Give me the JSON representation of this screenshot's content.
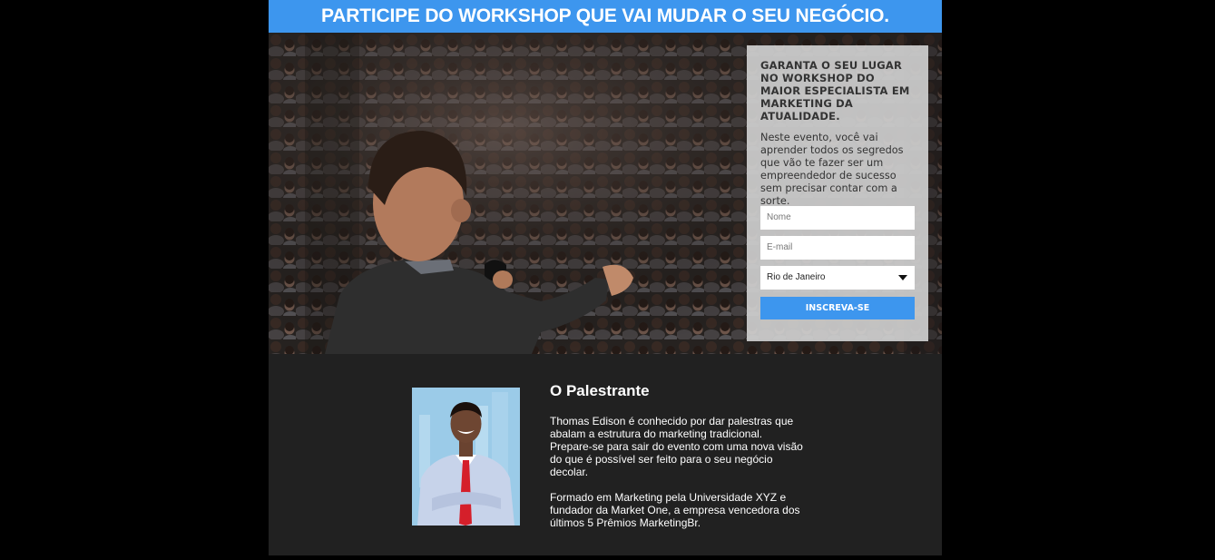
{
  "header": {
    "title": "PARTICIPE DO WORKSHOP QUE VAI MUDAR O SEU NEGÓCIO."
  },
  "signup": {
    "title": "GARANTA O SEU LUGAR NO WORKSHOP DO MAIOR ESPECIALISTA EM MARKETING DA ATUALIDADE.",
    "description": "Neste evento, você vai aprender todos os segredos que vão te fazer ser um empreendedor de sucesso sem precisar contar com a sorte.",
    "name_placeholder": "Nome",
    "email_placeholder": "E-mail",
    "city_selected": "Rio de Janeiro",
    "submit_label": "INSCREVA-SE"
  },
  "speaker": {
    "title": "O Palestrante",
    "paragraph1": "Thomas Edison é conhecido por dar palestras que abalam a estrutura do marketing tradicional. Prepare-se para sair do evento com uma nova visão do que é possível ser feito para o seu negócio decolar.",
    "paragraph2": "Formado em Marketing pela Universidade XYZ e fundador da Market One, a empresa vencedora dos últimos 5 Prêmios MarketingBr."
  },
  "colors": {
    "accent": "#3d96ee",
    "panel": "#212121",
    "form_bg": "#cdcdcd"
  }
}
